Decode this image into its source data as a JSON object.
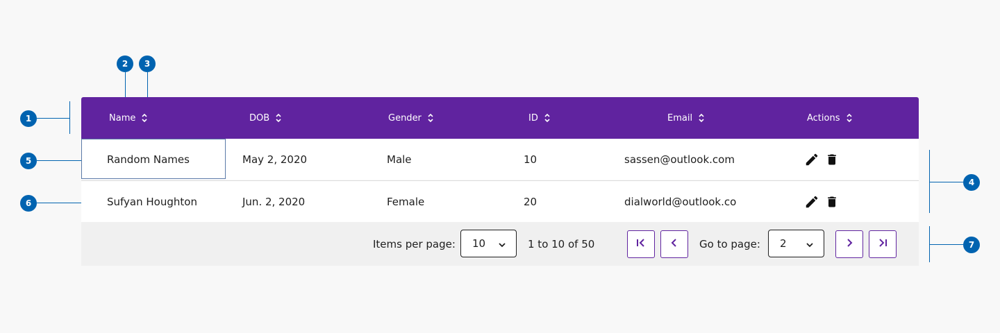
{
  "markers": [
    "1",
    "2",
    "3",
    "4",
    "5",
    "6",
    "7"
  ],
  "table": {
    "headers": [
      "Name",
      "DOB",
      "Gender",
      "ID",
      "Email",
      "Actions"
    ],
    "rows": [
      {
        "name": "Random Names",
        "dob": "May 2, 2020",
        "gender": "Male",
        "id": "10",
        "email": "sassen@outlook.com"
      },
      {
        "name": "Sufyan Houghton",
        "dob": "Jun. 2, 2020",
        "gender": "Female",
        "id": "20",
        "email": "dialworld@outlook.co"
      }
    ],
    "row_icons": [
      "edit-icon",
      "delete-icon"
    ]
  },
  "pagination": {
    "items_per_page_label": "Items per page:",
    "items_per_page_value": "10",
    "range_text": "1 to 10 of 50",
    "go_to_page_label": "Go to page:",
    "go_to_page_value": "2",
    "icons": [
      "first-page-icon",
      "previous-page-icon",
      "next-page-icon",
      "last-page-icon"
    ]
  },
  "colors": {
    "header_bg": "#60239f",
    "accent_blue": "#0063b0",
    "footer_bg": "#f0f0f0"
  }
}
